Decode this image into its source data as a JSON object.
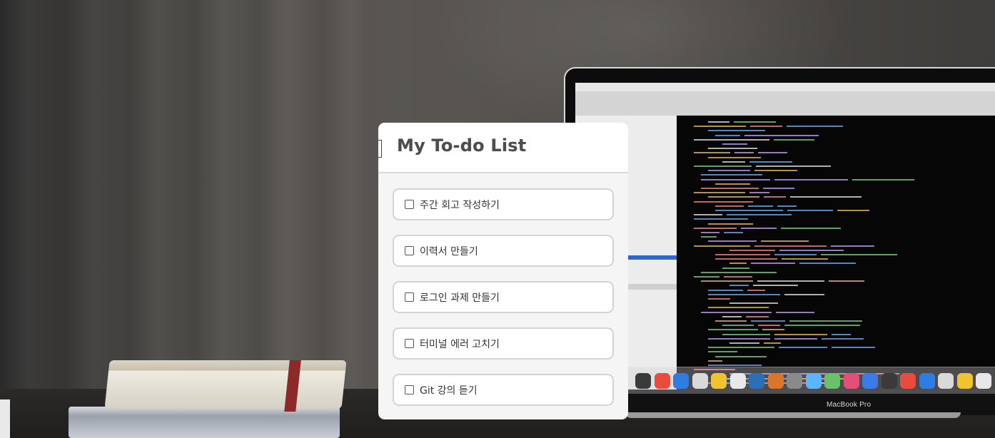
{
  "app": {
    "title": "My To-do List"
  },
  "todos": [
    {
      "label": "주간 회고 작성하기",
      "checked": false
    },
    {
      "label": "이력서 만들기",
      "checked": false
    },
    {
      "label": "로그인 과제 만들기",
      "checked": false
    },
    {
      "label": "터미널 에러 고치기",
      "checked": false
    },
    {
      "label": "Git 강의 듣기",
      "checked": false
    }
  ],
  "background": {
    "laptop_label": "MacBook Pro"
  },
  "colors": {
    "card_background": "#f5f5f5",
    "item_background": "#ffffff",
    "item_border": "#d3d3d3",
    "header_divider": "#d9d9d9",
    "title_text": "#4d4d4d"
  }
}
